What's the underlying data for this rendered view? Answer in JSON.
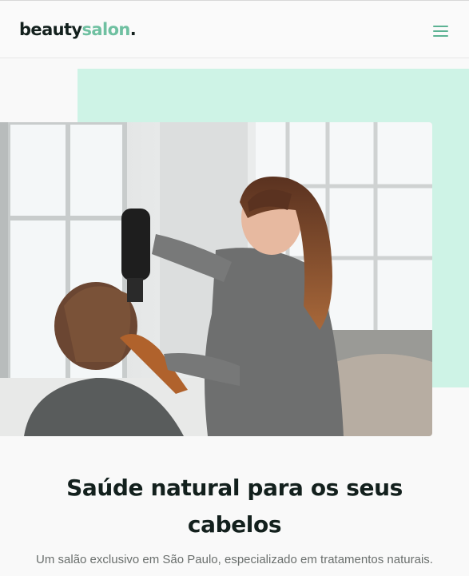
{
  "brand": {
    "name_dark": "beauty",
    "name_accent": "salon",
    "name_dot": "."
  },
  "nav": {
    "menu_icon": "hamburger-icon"
  },
  "hero": {
    "image_alt": "Cabeleireira secando o cabelo de uma cliente",
    "title": "Saúde natural para os seus cabelos",
    "subtitle": "Um salão exclusivo em São Paulo, especializado em tratamentos naturais."
  },
  "colors": {
    "accent": "#6fc0a1",
    "mint_block": "#cef3e6",
    "text_dark": "#13201d"
  }
}
